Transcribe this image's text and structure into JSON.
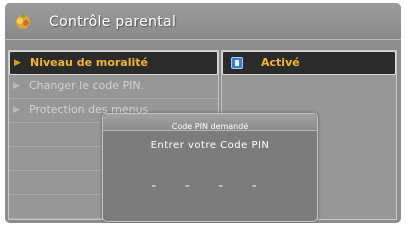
{
  "title_bar": {
    "title": "Contrôle parental",
    "icon": "parental-control-icon"
  },
  "menu": {
    "items": [
      {
        "label": "Niveau de moralité",
        "selected": true
      },
      {
        "label": "Changer le code PIN.",
        "selected": false
      },
      {
        "label": "Protection des menus",
        "selected": false
      }
    ]
  },
  "value_panel": {
    "value": "Activé",
    "icon": "info-icon"
  },
  "pin_dialog": {
    "title": "Code PIN demandé",
    "prompt": "Entrer votre Code PIN",
    "digits": "- - - -"
  },
  "colors": {
    "background": "#8d8d8d",
    "selected_text": "#f2b531",
    "selected_bg": "#2b2b2b"
  }
}
